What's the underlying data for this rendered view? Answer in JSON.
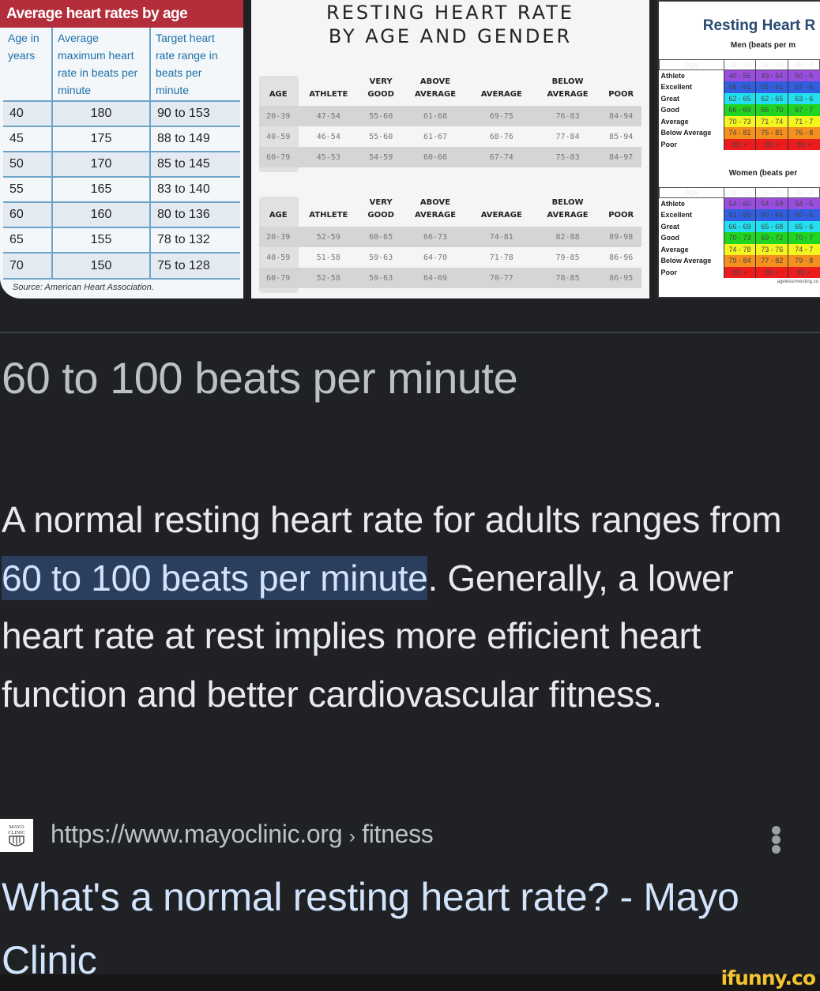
{
  "images": {
    "aha_table": {
      "title": "Average heart rates by age",
      "headers": [
        "Age in years",
        "Average maximum heart rate in beats per minute",
        "Target heart rate range in beats per minute"
      ],
      "rows": [
        [
          "40",
          "180",
          "90 to 153"
        ],
        [
          "45",
          "175",
          "88 to 149"
        ],
        [
          "50",
          "170",
          "85 to 145"
        ],
        [
          "55",
          "165",
          "83 to 140"
        ],
        [
          "60",
          "160",
          "80 to 136"
        ],
        [
          "65",
          "155",
          "78 to 132"
        ],
        [
          "70",
          "150",
          "75 to 128"
        ]
      ],
      "source": "Source: American Heart Association."
    },
    "gender_table": {
      "title_line1": "RESTING HEART RATE",
      "title_line2": "BY AGE AND GENDER",
      "headers": [
        "AGE",
        "ATHLETE",
        "VERY GOOD",
        "ABOVE AVERAGE",
        "AVERAGE",
        "BELOW AVERAGE",
        "POOR"
      ],
      "men_rows": [
        [
          "20-39",
          "47-54",
          "55-60",
          "61-68",
          "69-75",
          "76-83",
          "84-94"
        ],
        [
          "40-59",
          "46-54",
          "55-60",
          "61-67",
          "68-76",
          "77-84",
          "85-94"
        ],
        [
          "60-79",
          "45-53",
          "54-59",
          "60-66",
          "67-74",
          "75-83",
          "84-97"
        ]
      ],
      "women_rows": [
        [
          "20-39",
          "52-59",
          "60-65",
          "66-73",
          "74-81",
          "82-88",
          "89-98"
        ],
        [
          "40-59",
          "51-58",
          "59-63",
          "64-70",
          "71-78",
          "79-85",
          "86-96"
        ],
        [
          "60-79",
          "52-58",
          "59-63",
          "64-69",
          "70-77",
          "78-85",
          "86-95"
        ]
      ]
    },
    "color_table": {
      "title": "Resting Heart R",
      "men_subtitle": "Men (beats per m",
      "women_subtitle": "Women (beats per",
      "age_label": "Age",
      "age_columns": [
        "18 - 25",
        "26 - 35",
        "36 - 4"
      ],
      "categories": [
        {
          "label": "Athlete",
          "color": "#9b4de0"
        },
        {
          "label": "Excellent",
          "color": "#2f5ee0"
        },
        {
          "label": "Great",
          "color": "#22e0f0"
        },
        {
          "label": "Good",
          "color": "#22d422"
        },
        {
          "label": "Average",
          "color": "#f5f520"
        },
        {
          "label": "Below Average",
          "color": "#f5901e"
        },
        {
          "label": "Poor",
          "color": "#ec1c1c"
        }
      ],
      "men_values": [
        [
          "40 - 55",
          "49 - 54",
          "50 - 5"
        ],
        [
          "56 - 61",
          "55 - 61",
          "57 - 6"
        ],
        [
          "62 - 65",
          "62 - 65",
          "63 - 6"
        ],
        [
          "66 - 69",
          "66 - 70",
          "67 - 7"
        ],
        [
          "70 - 73",
          "71 - 74",
          "71 - 7"
        ],
        [
          "74 - 81",
          "75 - 81",
          "76 - 8"
        ],
        [
          "82 +",
          "82 +",
          "83 +"
        ]
      ],
      "women_values": [
        [
          "54 - 60",
          "54 - 59",
          "54 - 5"
        ],
        [
          "61 - 65",
          "60 - 64",
          "60 - 6"
        ],
        [
          "66 - 69",
          "65 - 68",
          "65 - 6"
        ],
        [
          "70 - 73",
          "69 - 72",
          "70 - 7"
        ],
        [
          "74 - 78",
          "73 - 76",
          "74 - 7"
        ],
        [
          "79 - 84",
          "77 - 82",
          "79 - 8"
        ],
        [
          "85 +",
          "83 +",
          "85 +"
        ]
      ],
      "credit": "agelessinvesting.co"
    }
  },
  "answer": {
    "headline": "60 to 100 beats per minute",
    "description_before": "A normal resting heart rate for adults ranges from ",
    "description_highlight": "60 to 100 beats per minute",
    "description_after": ". Generally, a lower heart rate at rest implies more efficient heart function and better cardiovascular fitness.",
    "highlight_color": "#2c3e5e"
  },
  "source": {
    "favicon_label": "MAYO CLINIC",
    "url": "https://www.mayoclinic.org",
    "breadcrumb_sep": "›",
    "breadcrumb_path": "fitness",
    "title": "What's a normal resting heart rate? - Mayo Clinic",
    "more_options_icon": "more-vert-icon"
  },
  "watermark": "ifunny.co"
}
